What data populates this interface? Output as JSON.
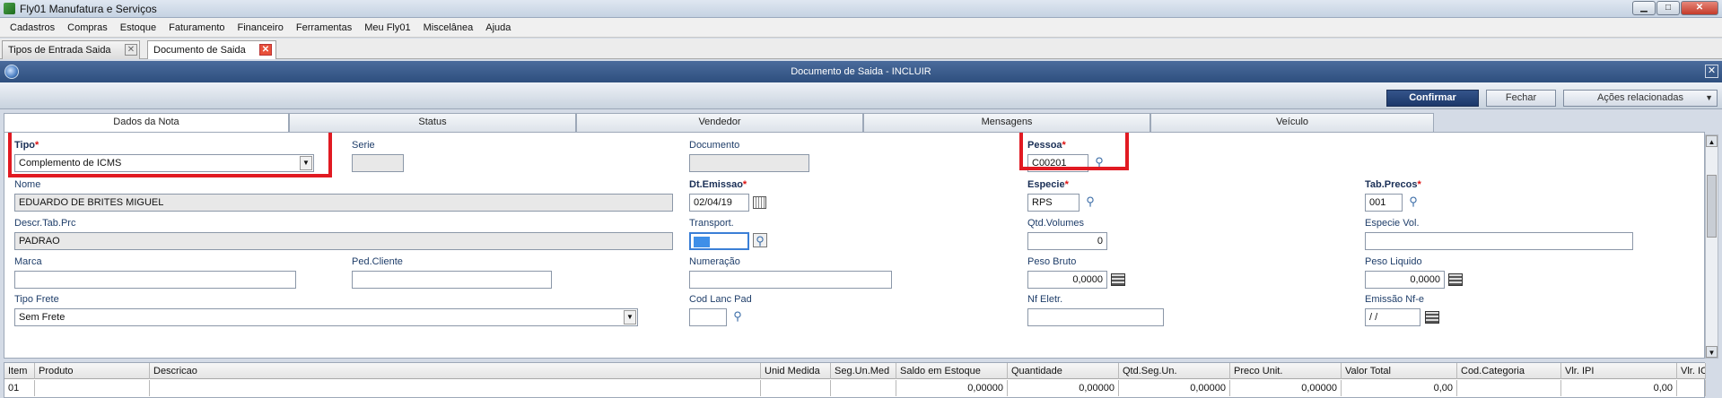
{
  "window": {
    "title": "Fly01 Manufatura e Serviços",
    "minimize": "▁",
    "maximize": "□",
    "close": "✕"
  },
  "menu": [
    "Cadastros",
    "Compras",
    "Estoque",
    "Faturamento",
    "Financeiro",
    "Ferramentas",
    "Meu Fly01",
    "Miscelânea",
    "Ajuda"
  ],
  "doc_tabs": [
    {
      "label": "Tipos de Entrada Saida",
      "close": "✕"
    },
    {
      "label": "Documento de Saida",
      "close": "✕"
    }
  ],
  "form": {
    "title": "Documento de Saida - INCLUIR",
    "close": "✕"
  },
  "buttons": {
    "confirm": "Confirmar",
    "close": "Fechar",
    "actions": "Ações relacionadas",
    "actions_caret": "▼"
  },
  "sections": [
    "Dados da Nota",
    "Status",
    "Vendedor",
    "Mensagens",
    "Veículo"
  ],
  "fields": {
    "tipo": {
      "label": "Tipo",
      "value": "Complemento de ICMS"
    },
    "serie": {
      "label": "Serie",
      "value": ""
    },
    "documento": {
      "label": "Documento",
      "value": ""
    },
    "pessoa": {
      "label": "Pessoa",
      "value": "C00201"
    },
    "nome": {
      "label": "Nome",
      "value": "EDUARDO DE BRITES MIGUEL"
    },
    "dt_emissao": {
      "label": "Dt.Emissao",
      "value": "02/04/19"
    },
    "especie": {
      "label": "Especie",
      "value": "RPS"
    },
    "tab_precos": {
      "label": "Tab.Precos",
      "value": "001"
    },
    "descr_tab_prc": {
      "label": "Descr.Tab.Prc",
      "value": "PADRAO"
    },
    "transport": {
      "label": "Transport.",
      "value": ""
    },
    "qtd_volumes": {
      "label": "Qtd.Volumes",
      "value": "0"
    },
    "especie_vol": {
      "label": "Especie Vol.",
      "value": ""
    },
    "marca": {
      "label": "Marca",
      "value": ""
    },
    "ped_cliente": {
      "label": "Ped.Cliente",
      "value": ""
    },
    "numeracao": {
      "label": "Numeração",
      "value": ""
    },
    "peso_bruto": {
      "label": "Peso Bruto",
      "value": "0,0000"
    },
    "peso_liquido": {
      "label": "Peso Liquido",
      "value": "0,0000"
    },
    "tipo_frete": {
      "label": "Tipo Frete",
      "value": "Sem Frete"
    },
    "cod_lanc_pad": {
      "label": "Cod Lanc Pad",
      "value": ""
    },
    "nf_eletr": {
      "label": "Nf Eletr.",
      "value": ""
    },
    "emissao_nfe": {
      "label": "Emissão Nf-e",
      "value": " / /"
    }
  },
  "required_mark": "*",
  "icons": {
    "search": "search-icon",
    "calendar": "calendar-icon",
    "calculator": "calculator-icon",
    "dropdown": "▼"
  },
  "colors": {
    "highlight": "#e11a22",
    "primary_button": "#1c386a",
    "header_bar": "#2e4f7e"
  },
  "grid": {
    "columns": [
      "Item",
      "Produto",
      "Descricao",
      "Unid Medida",
      "Seg.Un.Med",
      "Saldo em Estoque",
      "Quantidade",
      "Qtd.Seg.Un.",
      "Preco Unit.",
      "Valor Total",
      "Cod.Categoria",
      "Vlr. IPI",
      "Vlr. IC"
    ],
    "rows": [
      [
        "01",
        "",
        "",
        "",
        "",
        "0,00000",
        "0,00000",
        "0,00000",
        "0,00000",
        "0,00",
        "",
        "0,00",
        ""
      ]
    ]
  },
  "scroll": {
    "up": "▲",
    "down": "▼"
  }
}
